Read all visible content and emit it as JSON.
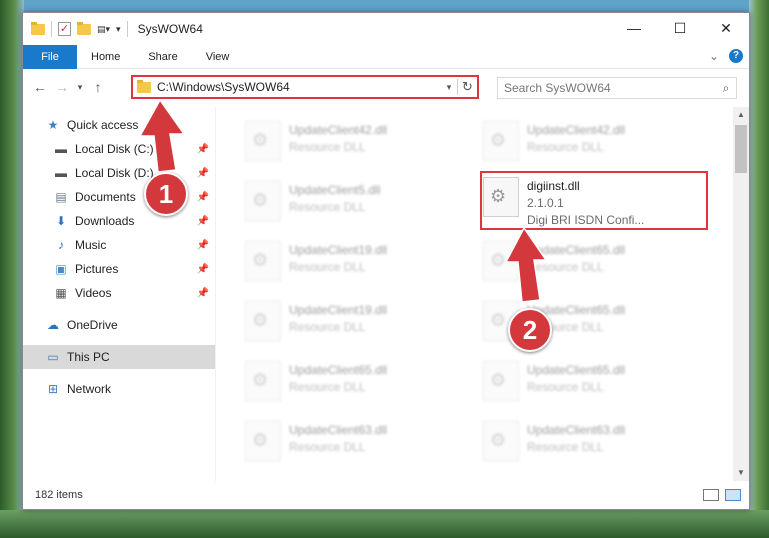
{
  "window": {
    "title": "SysWOW64",
    "controls": {
      "minimize": "—",
      "maximize": "☐",
      "close": "✕"
    }
  },
  "ribbon": {
    "tabs": [
      "File",
      "Home",
      "Share",
      "View"
    ],
    "collapse_glyph": "⌄",
    "help_glyph": "?"
  },
  "address_bar": {
    "path": "C:\\Windows\\SysWOW64",
    "search_placeholder": "Search SysWOW64"
  },
  "nav_pane": {
    "quick_access": "Quick access",
    "pinned": [
      {
        "label": "Local Disk (C:)",
        "icon": "drive-icon"
      },
      {
        "label": "Local Disk (D:)",
        "icon": "drive-icon"
      },
      {
        "label": "Documents",
        "icon": "documents-icon"
      },
      {
        "label": "Downloads",
        "icon": "downloads-icon"
      },
      {
        "label": "Music",
        "icon": "music-icon"
      },
      {
        "label": "Pictures",
        "icon": "pictures-icon"
      },
      {
        "label": "Videos",
        "icon": "videos-icon"
      }
    ],
    "onedrive": "OneDrive",
    "this_pc": "This PC",
    "network": "Network"
  },
  "files": {
    "highlighted": {
      "name": "digiinst.dll",
      "version": "2.1.0.1",
      "description": "Digi BRI ISDN Confi..."
    },
    "left_column": [
      {
        "name": "UpdateClient42.dll",
        "type": "Resource DLL"
      },
      {
        "name": "UpdateClient5.dll",
        "type": "Resource DLL"
      },
      {
        "name": "UpdateClient19.dll",
        "type": "Resource DLL"
      },
      {
        "name": "UpdateClient19.dll",
        "type": "Resource DLL"
      },
      {
        "name": "UpdateClient65.dll",
        "type": "Resource DLL"
      },
      {
        "name": "UpdateClient63.dll",
        "type": "Resource DLL"
      }
    ],
    "right_column": [
      {
        "name": "UpdateClient42.dll",
        "type": "Resource DLL"
      },
      {
        "name": "UpdateClient65.dll",
        "type": "Resource DLL"
      },
      {
        "name": "UpdateClient65.dll",
        "type": "Resource DLL"
      },
      {
        "name": "UpdateClient65.dll",
        "type": "Resource DLL"
      },
      {
        "name": "UpdateClient63.dll",
        "type": "Resource DLL"
      }
    ]
  },
  "status": {
    "item_count": "182 items"
  },
  "annotations": {
    "step1": "1",
    "step2": "2",
    "color": "#d2383c"
  }
}
